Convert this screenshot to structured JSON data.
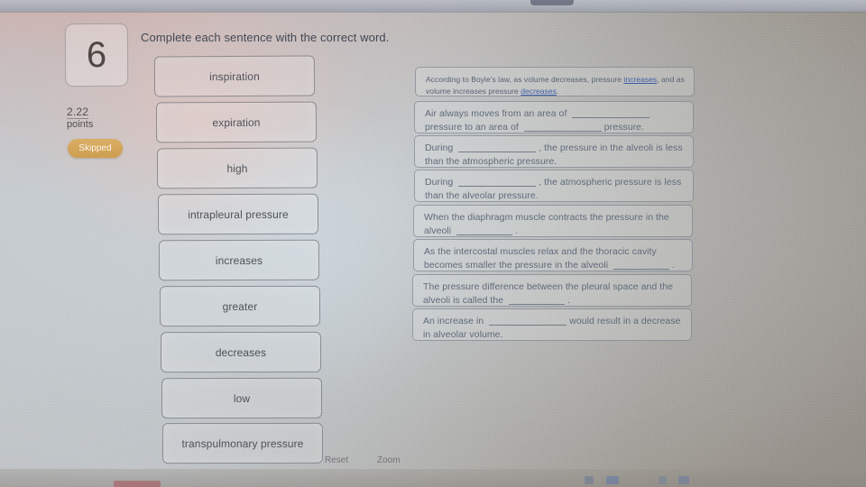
{
  "question": {
    "number": "6",
    "points_value": "2.22",
    "points_label": "points",
    "status_badge": "Skipped",
    "prompt": "Complete each sentence with the correct word."
  },
  "word_bank": {
    "items": [
      {
        "label": "inspiration"
      },
      {
        "label": "expiration"
      },
      {
        "label": "high"
      },
      {
        "label": "intrapleural pressure"
      },
      {
        "label": "increases"
      },
      {
        "label": "greater"
      },
      {
        "label": "decreases"
      },
      {
        "label": "low"
      },
      {
        "label": "transpulmonary pressure"
      }
    ]
  },
  "statements": [
    {
      "id": "boyles-law",
      "filled": true,
      "parts": [
        {
          "type": "text",
          "value": "According to Boyle's law, as volume decreases, pressure "
        },
        {
          "type": "answer",
          "value": "increases"
        },
        {
          "type": "text",
          "value": ", and as volume increases pressure "
        },
        {
          "type": "answer",
          "value": "decreases"
        },
        {
          "type": "text",
          "value": "."
        }
      ]
    },
    {
      "id": "air-moves-area",
      "filled": false,
      "parts": [
        {
          "type": "text",
          "value": "Air always moves from an area of "
        },
        {
          "type": "blank",
          "value": ""
        },
        {
          "type": "text",
          "value": "pressure to an area of "
        },
        {
          "type": "blank",
          "value": ""
        },
        {
          "type": "text",
          "value": "pressure."
        }
      ]
    },
    {
      "id": "during-alveoli-less",
      "filled": false,
      "parts": [
        {
          "type": "text",
          "value": "During "
        },
        {
          "type": "blank",
          "value": ""
        },
        {
          "type": "text",
          "value": ", the pressure in the alveoli is less than the atmospheric pressure."
        }
      ]
    },
    {
      "id": "during-atmospheric-less",
      "filled": false,
      "parts": [
        {
          "type": "text",
          "value": "During "
        },
        {
          "type": "blank",
          "value": ""
        },
        {
          "type": "text",
          "value": ", the atmospheric pressure is less than the alveolar pressure."
        }
      ]
    },
    {
      "id": "diaphragm-contracts",
      "filled": false,
      "parts": [
        {
          "type": "text",
          "value": "When the diaphragm muscle contracts the pressure in the alveoli "
        },
        {
          "type": "blank",
          "value": ""
        },
        {
          "type": "text",
          "value": "."
        }
      ]
    },
    {
      "id": "intercostal-relax",
      "filled": false,
      "parts": [
        {
          "type": "text",
          "value": "As the intercostal muscles relax and the thoracic cavity becomes smaller the pressure in the alveoli "
        },
        {
          "type": "blank",
          "value": ""
        },
        {
          "type": "text",
          "value": "."
        }
      ]
    },
    {
      "id": "pleural-alveoli-difference",
      "filled": false,
      "parts": [
        {
          "type": "text",
          "value": "The pressure difference between the pleural space and the alveoli is called the "
        },
        {
          "type": "blank",
          "value": ""
        },
        {
          "type": "text",
          "value": "."
        }
      ]
    },
    {
      "id": "increase-decrease-volume",
      "filled": false,
      "parts": [
        {
          "type": "text",
          "value": "An increase in "
        },
        {
          "type": "blank",
          "value": ""
        },
        {
          "type": "text",
          "value": "would result in a decrease in alveolar volume."
        }
      ]
    }
  ],
  "footer": {
    "reset_label": "Reset",
    "zoom_label": "Zoom"
  },
  "colors": {
    "badge_skipped": "#cf9d4c",
    "answer_text": "#3d5ca8",
    "statement_text": "#5c6878",
    "chip_text": "#4c5058"
  }
}
